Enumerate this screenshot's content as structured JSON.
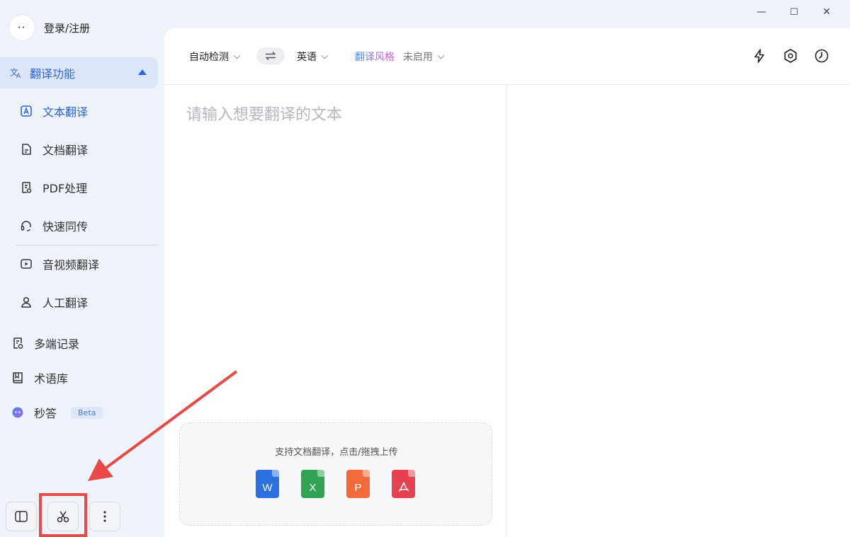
{
  "window": {
    "minimize": "—",
    "maximize": "☐",
    "close": "✕"
  },
  "user": {
    "avatar": "··",
    "label": "登录/注册"
  },
  "sidebar": {
    "section": {
      "label": "翻译功能"
    },
    "items": [
      {
        "label": "文本翻译",
        "icon": "text-translate-icon"
      },
      {
        "label": "文档翻译",
        "icon": "document-icon"
      },
      {
        "label": "PDF处理",
        "icon": "pdf-icon"
      },
      {
        "label": "快速同传",
        "icon": "headset-icon"
      },
      {
        "label": "音视频翻译",
        "icon": "video-icon"
      },
      {
        "label": "人工翻译",
        "icon": "person-icon"
      }
    ],
    "top_items": [
      {
        "label": "多端记录",
        "icon": "record-icon"
      },
      {
        "label": "术语库",
        "icon": "book-icon"
      },
      {
        "label": "秒答",
        "icon": "ai-icon",
        "badge": "Beta"
      }
    ]
  },
  "toolbar": {
    "source_lang": "自动检测",
    "target_lang": "英语",
    "style_label": "翻译风格",
    "style_value": "未启用"
  },
  "input": {
    "placeholder": "请输入想要翻译的文本"
  },
  "upload": {
    "text": "支持文档翻译，点击/拖拽上传",
    "files": [
      {
        "letter": "W",
        "color": "#2b6fe0"
      },
      {
        "letter": "X",
        "color": "#31a453"
      },
      {
        "letter": "P",
        "color": "#f36a3a"
      },
      {
        "letter": "",
        "color": "#e8414f"
      }
    ]
  },
  "colors": {
    "accent": "#2c64e3",
    "annotation": "#e94949"
  }
}
